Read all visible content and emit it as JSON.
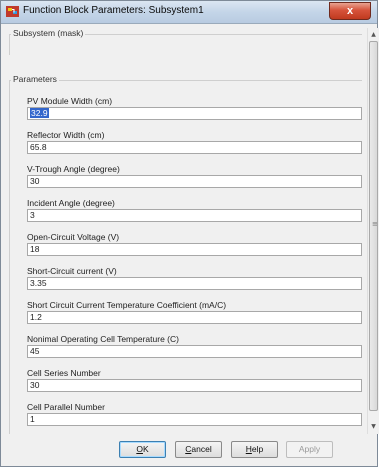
{
  "window": {
    "title": "Function Block Parameters: Subsystem1",
    "close_label": "x"
  },
  "mask_section": {
    "legend": "Subsystem (mask)"
  },
  "parameters_section": {
    "legend": "Parameters",
    "fields": [
      {
        "label": "PV Module Width (cm)",
        "value": "32.9"
      },
      {
        "label": "Reflector Width (cm)",
        "value": "65.8"
      },
      {
        "label": "V-Trough Angle (degree)",
        "value": "30"
      },
      {
        "label": "Incident Angle (degree)",
        "value": "3"
      },
      {
        "label": "Open-Circuit Voltage (V)",
        "value": "18"
      },
      {
        "label": "Short-Circuit current (V)",
        "value": "3.35"
      },
      {
        "label": "Short Circuit Current Temperature Coefficient (mA/C)",
        "value": "1.2"
      },
      {
        "label": "Nonimal Operating Cell Temperature (C)",
        "value": "45"
      },
      {
        "label": "Cell Series Number",
        "value": "30"
      },
      {
        "label": "Cell Parallel Number",
        "value": "1"
      }
    ]
  },
  "buttons": {
    "ok": "OK",
    "cancel": "Cancel",
    "help": "Help",
    "apply": "Apply"
  },
  "scrollbar": {
    "up_icon": "arrow-up-icon",
    "down_icon": "arrow-down-icon"
  }
}
